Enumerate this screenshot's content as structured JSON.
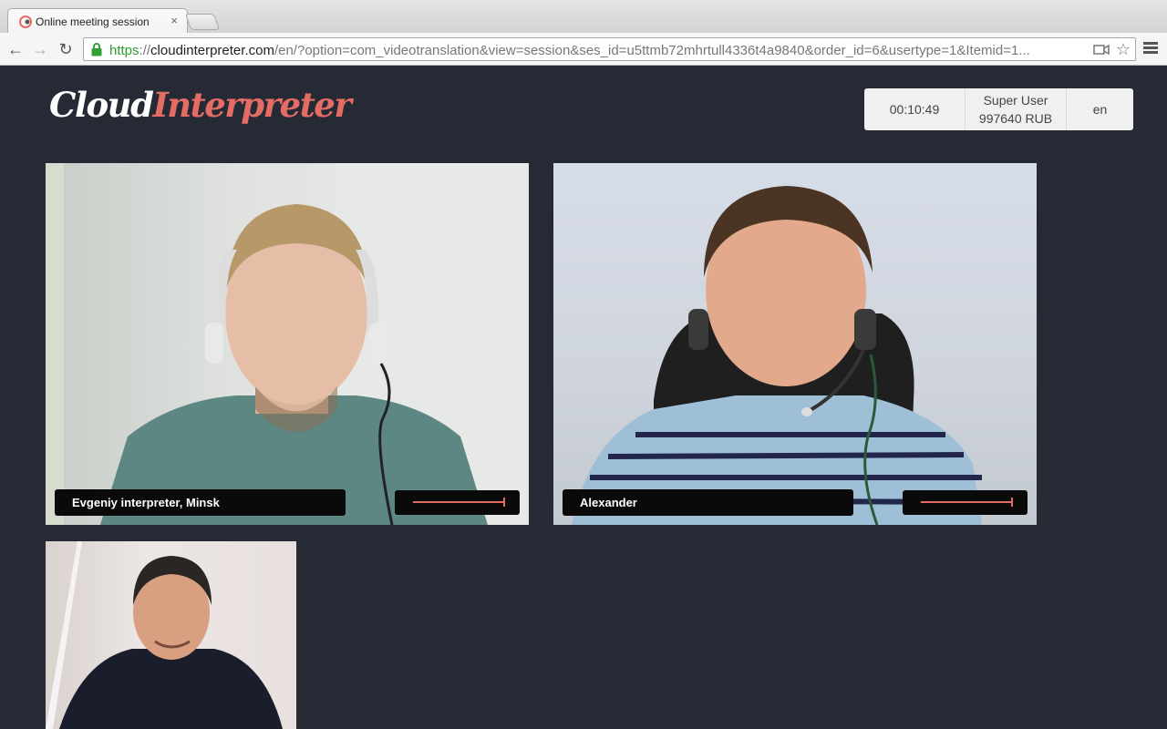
{
  "browser": {
    "tab_title": "Online meeting session",
    "tab_close": "×",
    "url_scheme": "https",
    "url_sep": "://",
    "url_host": "cloudinterpreter.com",
    "url_rest": "/en/?option=com_videotranslation&view=session&ses_id=u5ttmb72mhrtull4336t4a9840&order_id=6&usertype=1&Itemid=1..."
  },
  "app": {
    "logo_part1": "Cloud",
    "logo_part2": "Interpreter",
    "timer": "00:10:49",
    "user_name": "Super User",
    "user_balance": "997640 RUB",
    "language": "en"
  },
  "participants": [
    {
      "name": "Evgeniy interpreter, Minsk",
      "volume": 1.0
    },
    {
      "name": "Alexander",
      "volume": 1.0
    },
    {
      "name": "",
      "volume": null
    }
  ],
  "colors": {
    "accent": "#e46c65",
    "background": "#252a35"
  }
}
